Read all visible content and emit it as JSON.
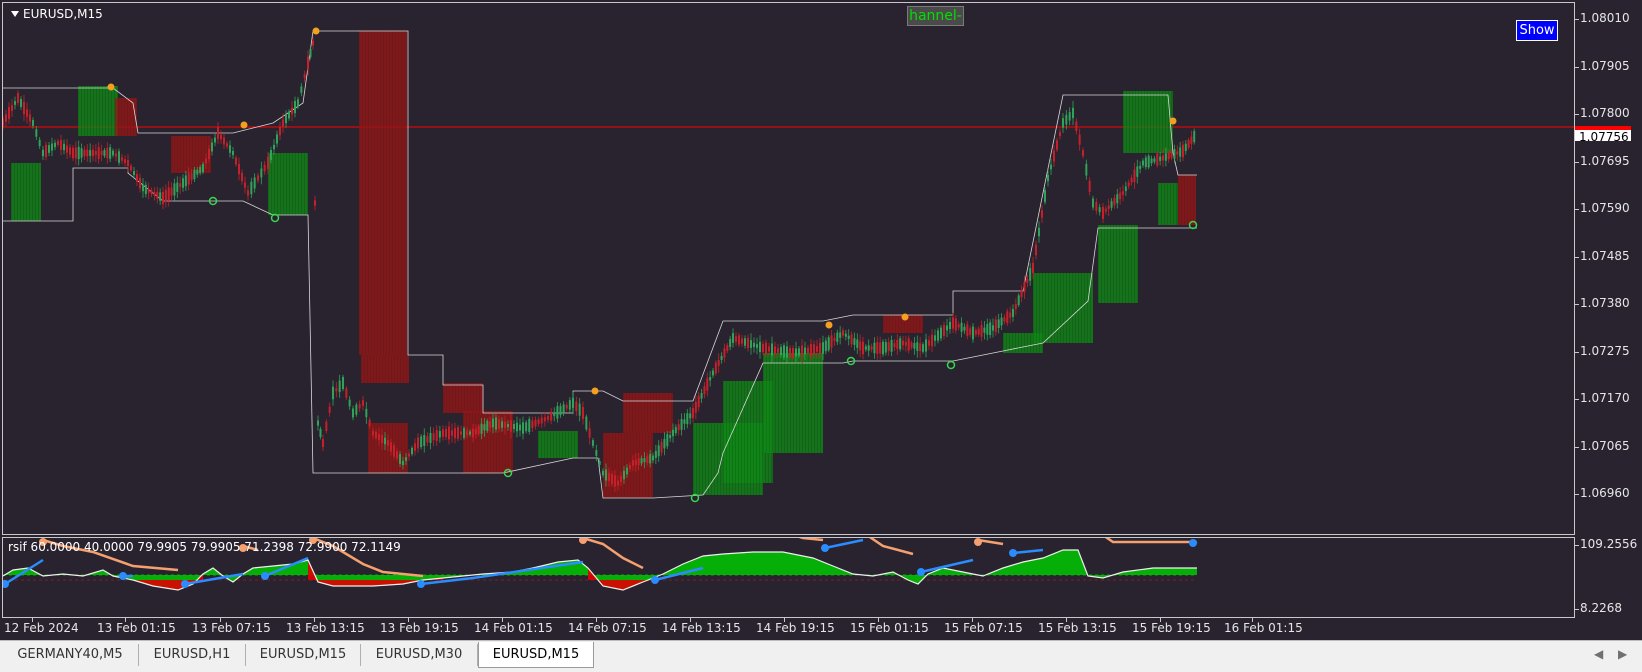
{
  "chart": {
    "symbol_title": "EURUSD,M15",
    "channel_badge": "hannel-",
    "show_button": "Show",
    "current_price": "1.07756",
    "price_labels": [
      "1.08010",
      "1.07905",
      "1.07800",
      "1.07695",
      "1.07590",
      "1.07485",
      "1.07380",
      "1.07275",
      "1.07170",
      "1.07065",
      "1.06960"
    ],
    "indicator_labels": [
      "109.2556",
      "8.2268"
    ],
    "indicator_legend": "rsif  60.0000 40.0000 79.9905 79.9905 71.2398 72.9900 72.1149",
    "time_labels": [
      "12 Feb 2024",
      "13 Feb 01:15",
      "13 Feb 07:15",
      "13 Feb 13:15",
      "13 Feb 19:15",
      "14 Feb 01:15",
      "14 Feb 07:15",
      "14 Feb 13:15",
      "14 Feb 19:15",
      "15 Feb 01:15",
      "15 Feb 07:15",
      "15 Feb 13:15",
      "15 Feb 19:15",
      "16 Feb 01:15"
    ]
  },
  "colors": {
    "background": "#28232e",
    "bull_candle": "#2fa35a",
    "bear_candle": "#c8202a",
    "bull_fill": "#0c7a12",
    "bear_fill": "#8a1515",
    "price_line": "#ff0000",
    "marker_orange": "#f3a020",
    "marker_green": "#36d850",
    "rsi_green": "#00c800",
    "rsi_red": "#e00000",
    "line_orange": "#f5a070",
    "line_blue": "#2a8cff"
  },
  "tabs": [
    {
      "label": "GERMANY40,M5",
      "active": false
    },
    {
      "label": "EURUSD,H1",
      "active": false
    },
    {
      "label": "EURUSD,M15",
      "active": false
    },
    {
      "label": "EURUSD,M30",
      "active": false
    },
    {
      "label": "EURUSD,M15",
      "active": true
    }
  ]
}
